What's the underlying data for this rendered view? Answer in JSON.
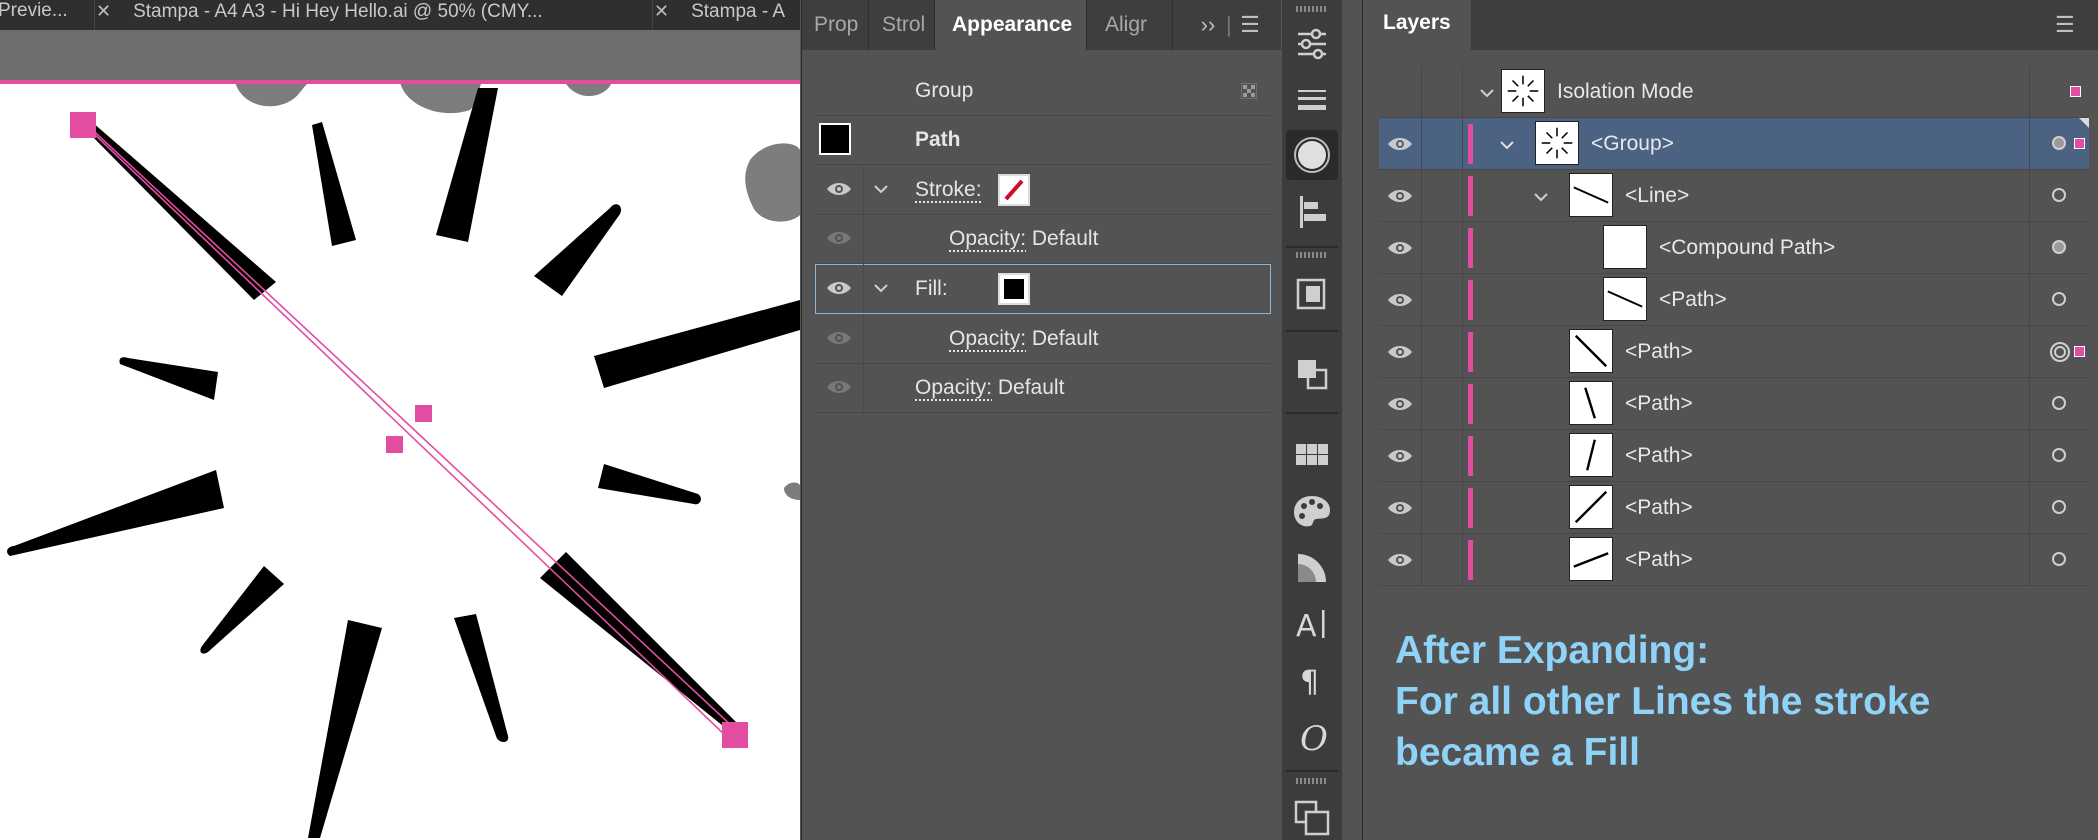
{
  "document_tabs": [
    {
      "label": "Previe..."
    },
    {
      "label": "Stampa - A4 A3 - Hi Hey Hello.ai @ 50% (CMY..."
    },
    {
      "label": "Stampa - A"
    }
  ],
  "appearance_panel": {
    "tabs": [
      {
        "label": "Prop"
      },
      {
        "label": "Strol"
      },
      {
        "label": "Appearance",
        "active": true
      },
      {
        "label": "Aligr"
      }
    ],
    "group_label": "Group",
    "path_label": "Path",
    "stroke_label": "Stroke:",
    "stroke_opacity_label": "Opacity:",
    "stroke_opacity_value": "Default",
    "fill_label": "Fill:",
    "fill_opacity_label": "Opacity:",
    "fill_opacity_value": "Default",
    "opacity_label": "Opacity:",
    "opacity_value": "Default"
  },
  "layers_panel": {
    "title": "Layers",
    "rows": [
      {
        "name": "Isolation Mode",
        "visible": false
      },
      {
        "name": "<Group>",
        "selected": true
      },
      {
        "name": "<Line>"
      },
      {
        "name": "<Compound Path>"
      },
      {
        "name": "<Path>"
      },
      {
        "name": "<Path>"
      },
      {
        "name": "<Path>"
      },
      {
        "name": "<Path>"
      },
      {
        "name": "<Path>"
      },
      {
        "name": "<Path>"
      }
    ]
  },
  "note": {
    "line1": "After Expanding:",
    "line2": "For all other Lines the stroke",
    "line3": "became a Fill"
  },
  "colors": {
    "accent_pink": "#e24da1",
    "selection_blue": "#4b6282",
    "note_blue": "#8fd3f8",
    "panel_bg": "#535353"
  },
  "icons": [
    "eye-icon",
    "chevron-down-icon",
    "stroke-swatch-icon",
    "fill-swatch-icon",
    "panel-menu-icon",
    "expand-panels-icon"
  ]
}
